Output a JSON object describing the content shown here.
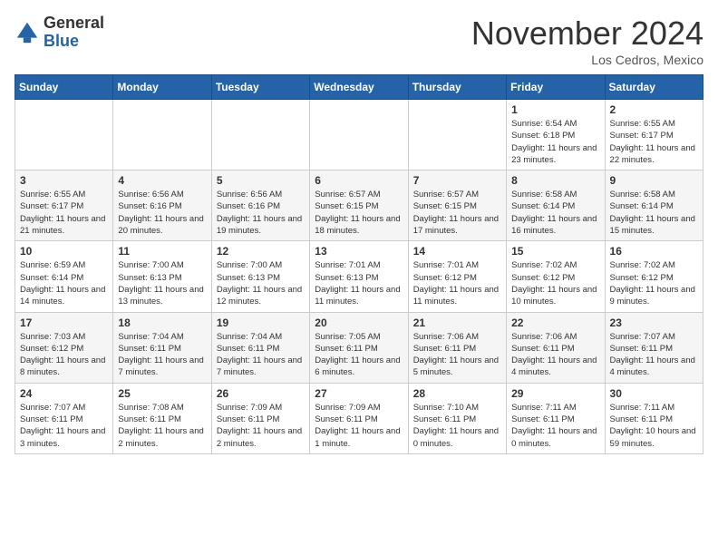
{
  "header": {
    "logo_general": "General",
    "logo_blue": "Blue",
    "month_title": "November 2024",
    "location": "Los Cedros, Mexico"
  },
  "calendar": {
    "days_of_week": [
      "Sunday",
      "Monday",
      "Tuesday",
      "Wednesday",
      "Thursday",
      "Friday",
      "Saturday"
    ],
    "weeks": [
      [
        {
          "day": "",
          "info": ""
        },
        {
          "day": "",
          "info": ""
        },
        {
          "day": "",
          "info": ""
        },
        {
          "day": "",
          "info": ""
        },
        {
          "day": "",
          "info": ""
        },
        {
          "day": "1",
          "info": "Sunrise: 6:54 AM\nSunset: 6:18 PM\nDaylight: 11 hours and 23 minutes."
        },
        {
          "day": "2",
          "info": "Sunrise: 6:55 AM\nSunset: 6:17 PM\nDaylight: 11 hours and 22 minutes."
        }
      ],
      [
        {
          "day": "3",
          "info": "Sunrise: 6:55 AM\nSunset: 6:17 PM\nDaylight: 11 hours and 21 minutes."
        },
        {
          "day": "4",
          "info": "Sunrise: 6:56 AM\nSunset: 6:16 PM\nDaylight: 11 hours and 20 minutes."
        },
        {
          "day": "5",
          "info": "Sunrise: 6:56 AM\nSunset: 6:16 PM\nDaylight: 11 hours and 19 minutes."
        },
        {
          "day": "6",
          "info": "Sunrise: 6:57 AM\nSunset: 6:15 PM\nDaylight: 11 hours and 18 minutes."
        },
        {
          "day": "7",
          "info": "Sunrise: 6:57 AM\nSunset: 6:15 PM\nDaylight: 11 hours and 17 minutes."
        },
        {
          "day": "8",
          "info": "Sunrise: 6:58 AM\nSunset: 6:14 PM\nDaylight: 11 hours and 16 minutes."
        },
        {
          "day": "9",
          "info": "Sunrise: 6:58 AM\nSunset: 6:14 PM\nDaylight: 11 hours and 15 minutes."
        }
      ],
      [
        {
          "day": "10",
          "info": "Sunrise: 6:59 AM\nSunset: 6:14 PM\nDaylight: 11 hours and 14 minutes."
        },
        {
          "day": "11",
          "info": "Sunrise: 7:00 AM\nSunset: 6:13 PM\nDaylight: 11 hours and 13 minutes."
        },
        {
          "day": "12",
          "info": "Sunrise: 7:00 AM\nSunset: 6:13 PM\nDaylight: 11 hours and 12 minutes."
        },
        {
          "day": "13",
          "info": "Sunrise: 7:01 AM\nSunset: 6:13 PM\nDaylight: 11 hours and 11 minutes."
        },
        {
          "day": "14",
          "info": "Sunrise: 7:01 AM\nSunset: 6:12 PM\nDaylight: 11 hours and 11 minutes."
        },
        {
          "day": "15",
          "info": "Sunrise: 7:02 AM\nSunset: 6:12 PM\nDaylight: 11 hours and 10 minutes."
        },
        {
          "day": "16",
          "info": "Sunrise: 7:02 AM\nSunset: 6:12 PM\nDaylight: 11 hours and 9 minutes."
        }
      ],
      [
        {
          "day": "17",
          "info": "Sunrise: 7:03 AM\nSunset: 6:12 PM\nDaylight: 11 hours and 8 minutes."
        },
        {
          "day": "18",
          "info": "Sunrise: 7:04 AM\nSunset: 6:11 PM\nDaylight: 11 hours and 7 minutes."
        },
        {
          "day": "19",
          "info": "Sunrise: 7:04 AM\nSunset: 6:11 PM\nDaylight: 11 hours and 7 minutes."
        },
        {
          "day": "20",
          "info": "Sunrise: 7:05 AM\nSunset: 6:11 PM\nDaylight: 11 hours and 6 minutes."
        },
        {
          "day": "21",
          "info": "Sunrise: 7:06 AM\nSunset: 6:11 PM\nDaylight: 11 hours and 5 minutes."
        },
        {
          "day": "22",
          "info": "Sunrise: 7:06 AM\nSunset: 6:11 PM\nDaylight: 11 hours and 4 minutes."
        },
        {
          "day": "23",
          "info": "Sunrise: 7:07 AM\nSunset: 6:11 PM\nDaylight: 11 hours and 4 minutes."
        }
      ],
      [
        {
          "day": "24",
          "info": "Sunrise: 7:07 AM\nSunset: 6:11 PM\nDaylight: 11 hours and 3 minutes."
        },
        {
          "day": "25",
          "info": "Sunrise: 7:08 AM\nSunset: 6:11 PM\nDaylight: 11 hours and 2 minutes."
        },
        {
          "day": "26",
          "info": "Sunrise: 7:09 AM\nSunset: 6:11 PM\nDaylight: 11 hours and 2 minutes."
        },
        {
          "day": "27",
          "info": "Sunrise: 7:09 AM\nSunset: 6:11 PM\nDaylight: 11 hours and 1 minute."
        },
        {
          "day": "28",
          "info": "Sunrise: 7:10 AM\nSunset: 6:11 PM\nDaylight: 11 hours and 0 minutes."
        },
        {
          "day": "29",
          "info": "Sunrise: 7:11 AM\nSunset: 6:11 PM\nDaylight: 11 hours and 0 minutes."
        },
        {
          "day": "30",
          "info": "Sunrise: 7:11 AM\nSunset: 6:11 PM\nDaylight: 10 hours and 59 minutes."
        }
      ]
    ]
  }
}
